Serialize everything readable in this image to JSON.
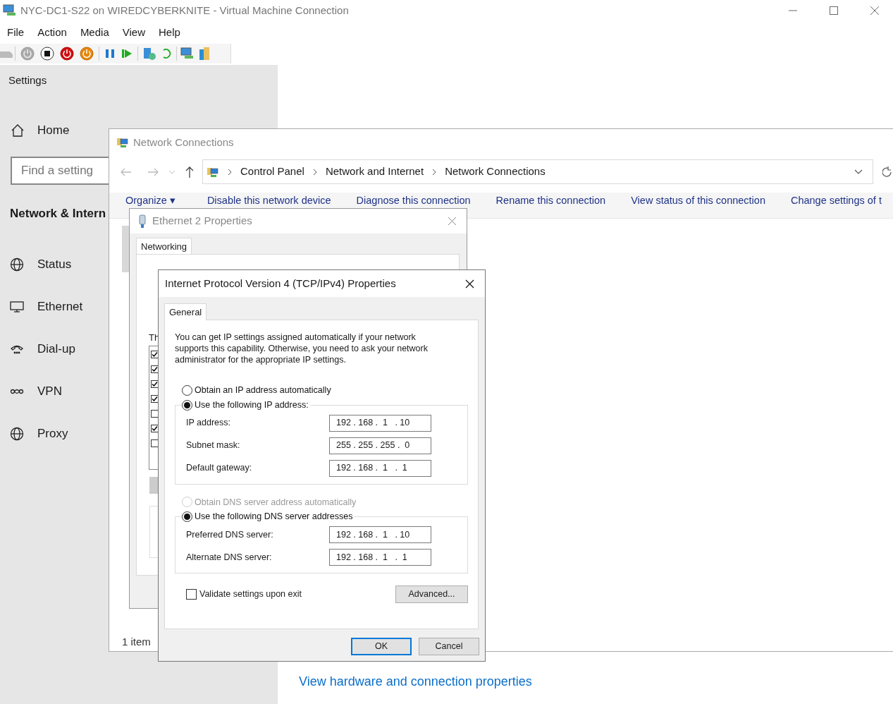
{
  "window": {
    "title": "NYC-DC1-S22 on WIREDCYBERKNITE - Virtual Machine Connection"
  },
  "menu": [
    "File",
    "Action",
    "Media",
    "View",
    "Help"
  ],
  "settings": {
    "title": "Settings",
    "home": "Home",
    "search": {
      "placeholder": "Find a setting"
    },
    "section": "Network & Intern",
    "nav": [
      {
        "label": "Status",
        "kind": "status"
      },
      {
        "label": "Ethernet",
        "kind": "ethernet"
      },
      {
        "label": "Dial-up",
        "kind": "dialup"
      },
      {
        "label": "VPN",
        "kind": "vpn"
      },
      {
        "label": "Proxy",
        "kind": "proxy"
      }
    ]
  },
  "status_page": {
    "link": "View hardware and connection properties"
  },
  "network_connections": {
    "title": "Network Connections",
    "breadcrumb": [
      "Control Panel",
      "Network and Internet",
      "Network Connections"
    ],
    "commands": [
      "Organize ▾",
      "Disable this network device",
      "Diagnose this connection",
      "Rename this connection",
      "View status of this connection",
      "Change settings of t"
    ],
    "status_bar": "1 item"
  },
  "ethernet_properties": {
    "title": "Ethernet 2 Properties",
    "tabs": [
      {
        "label": "Networking",
        "selected": true
      }
    ],
    "list_label": "Th",
    "components": [
      {
        "checked": true
      },
      {
        "checked": true
      },
      {
        "checked": true
      },
      {
        "checked": true
      },
      {
        "checked": false
      },
      {
        "checked": true
      },
      {
        "checked": false
      }
    ]
  },
  "ipv4": {
    "title": "Internet Protocol Version 4 (TCP/IPv4) Properties",
    "tabs": [
      {
        "label": "General",
        "selected": true
      }
    ],
    "description": "You can get IP settings assigned automatically if your network supports this capability. Otherwise, you need to ask your network administrator for the appropriate IP settings.",
    "ip_auto": {
      "label": "Obtain an IP address automatically",
      "selected": false,
      "disabled": false
    },
    "ip_manual": {
      "label": "Use the following IP address:",
      "selected": true,
      "disabled": false
    },
    "ip_fields": [
      {
        "label": "IP address:",
        "value": "192 . 168 .  1   . 10"
      },
      {
        "label": "Subnet mask:",
        "value": "255 . 255 . 255 .  0"
      },
      {
        "label": "Default gateway:",
        "value": "192 . 168 .  1   .  1"
      }
    ],
    "dns_auto": {
      "label": "Obtain DNS server address automatically",
      "selected": false,
      "disabled": true
    },
    "dns_manual": {
      "label": "Use the following DNS server addresses",
      "selected": true,
      "disabled": false
    },
    "dns_fields": [
      {
        "label": "Preferred DNS server:",
        "value": "192 . 168 .  1   . 10"
      },
      {
        "label": "Alternate DNS server:",
        "value": "192 . 168 .  1   .  1"
      }
    ],
    "validate": {
      "label": "Validate settings upon exit",
      "checked": false
    },
    "advanced": "Advanced...",
    "ok": "OK",
    "cancel": "Cancel"
  }
}
